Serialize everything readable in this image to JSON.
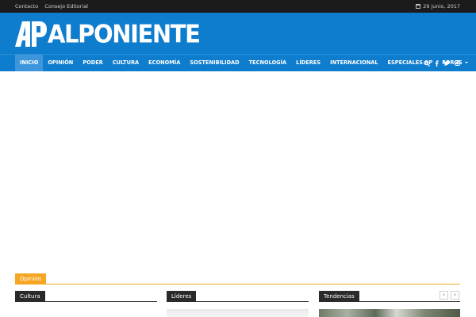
{
  "topbar": {
    "links": [
      "Contacto",
      "Consejo Editorial"
    ],
    "date": "29 junio, 2017"
  },
  "brand": {
    "logo_text": "ALPONIENTE",
    "colors": {
      "primary": "#0f7dce",
      "accent": "#f5a623",
      "dark": "#2a2a2a"
    }
  },
  "nav": {
    "items": [
      "INICIO",
      "OPINIÓN",
      "PODER",
      "CULTURA",
      "ECONOMÍA",
      "SOSTENIBILIDAD",
      "TECNOLOGÍA",
      "LÍDERES",
      "INTERNACIONAL",
      "ESPECIALES AP",
      "FOROS"
    ],
    "icons": [
      "search-icon",
      "facebook-icon",
      "twitter-icon",
      "instagram-icon"
    ]
  },
  "sections": {
    "opinion": "Opinión",
    "cultura": "Cultura",
    "lideres": "Líderes",
    "tendencias": "Tendencias"
  },
  "slider": {
    "prev": "‹",
    "next": "›"
  }
}
